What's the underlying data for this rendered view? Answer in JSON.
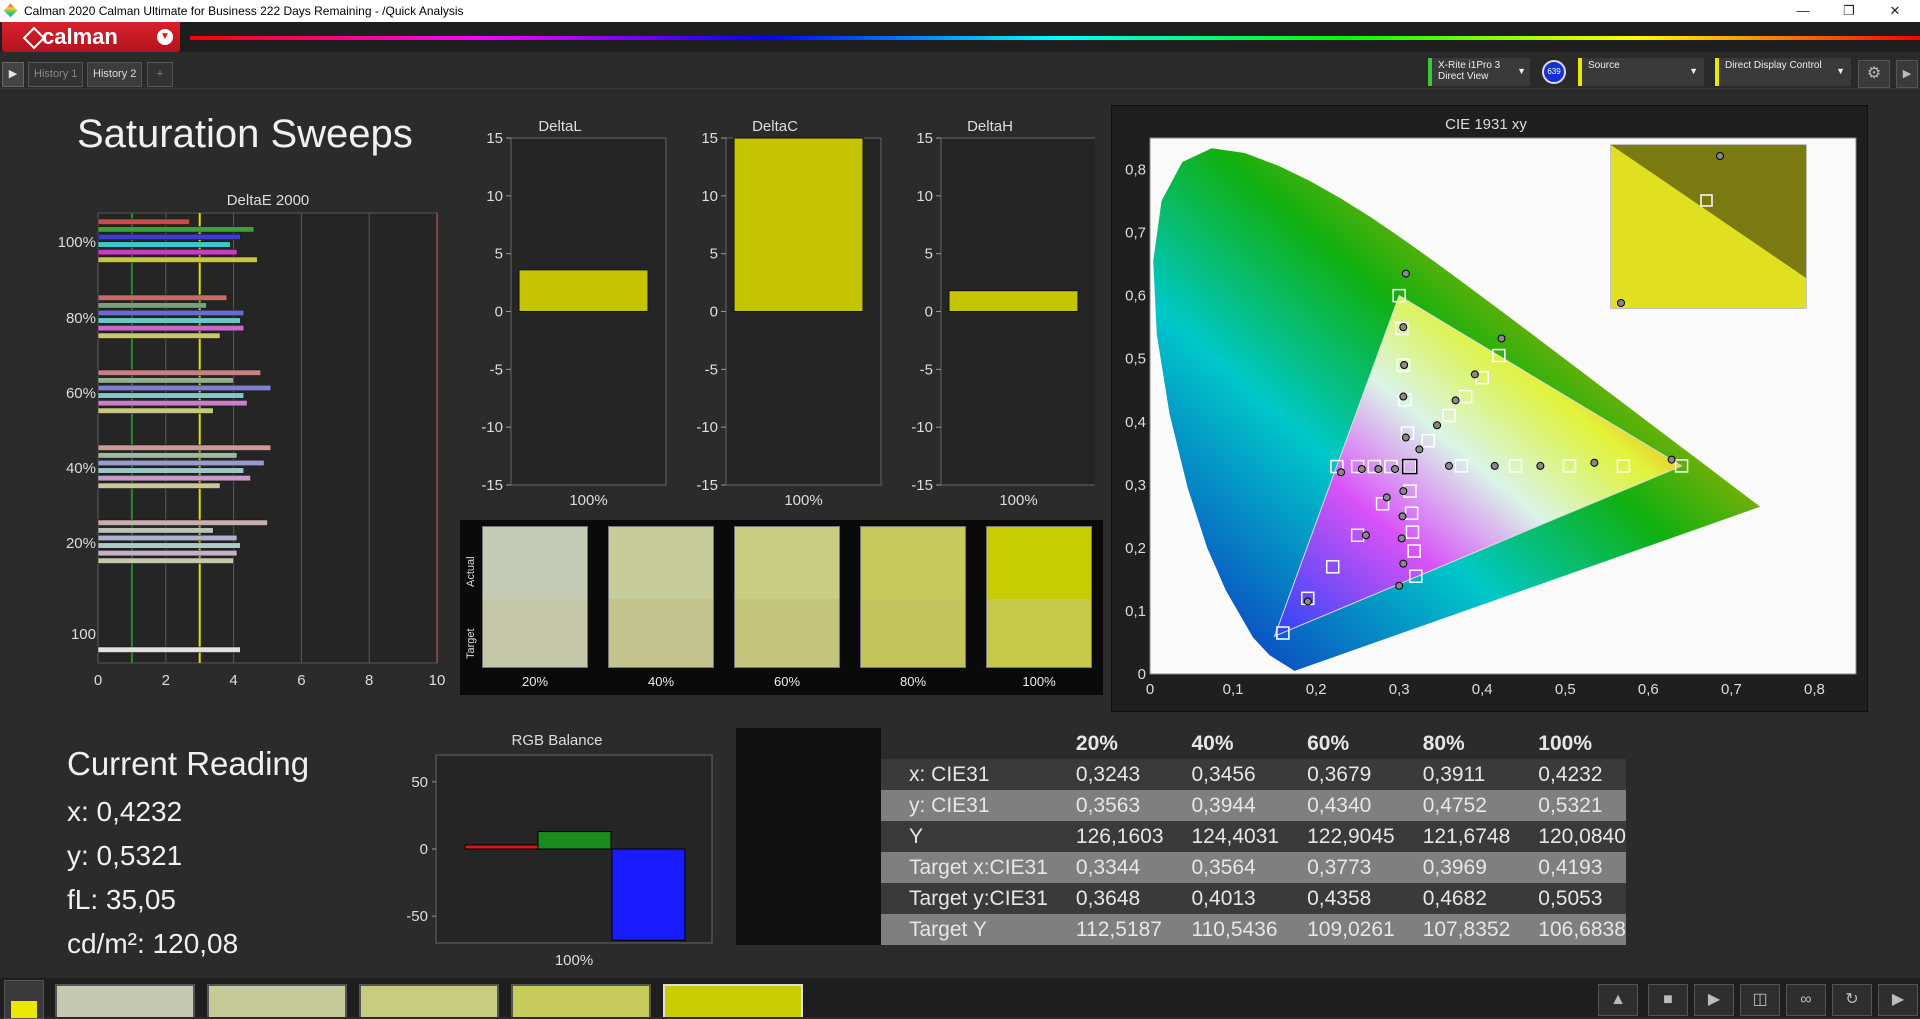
{
  "window": {
    "title": "Calman 2020 Calman Ultimate for Business 222 Days Remaining - /Quick Analysis"
  },
  "logo": {
    "text": "calman"
  },
  "tabs": [
    {
      "label": "History 1"
    },
    {
      "label": "History 2"
    },
    {
      "label": "+"
    }
  ],
  "devices": {
    "meter_line1": "X-Rite i1Pro 3",
    "meter_line2": "Direct View",
    "meter_badge": "639",
    "source": "Source",
    "display": "Direct Display Control"
  },
  "page_title": "Saturation Sweeps",
  "deltaE": {
    "title": "DeltaE 2000",
    "x_ticks": [
      "0",
      "2",
      "4",
      "6",
      "8",
      "10"
    ],
    "x_range": [
      0,
      10
    ],
    "group_labels": [
      "100%",
      "80%",
      "60%",
      "40%",
      "20%",
      "100"
    ],
    "groups": [
      {
        "colors": [
          "#c84a4a",
          "#3aa03a",
          "#3c3cd0",
          "#3cc8c8",
          "#c83cc8",
          "#c8c83c"
        ],
        "values": [
          2.7,
          4.6,
          4.2,
          3.9,
          4.1,
          4.7
        ]
      },
      {
        "colors": [
          "#c86a6a",
          "#7aa07a",
          "#6a6ad0",
          "#6ac8c8",
          "#c86ac8",
          "#c8c86a"
        ],
        "values": [
          3.8,
          3.2,
          4.3,
          4.2,
          4.3,
          3.6
        ]
      },
      {
        "colors": [
          "#c88080",
          "#90b090",
          "#8080d0",
          "#80c8c8",
          "#c880c8",
          "#c8c880"
        ],
        "values": [
          4.8,
          4.0,
          5.1,
          4.3,
          4.4,
          3.4
        ]
      },
      {
        "colors": [
          "#c89a9a",
          "#a0b8a0",
          "#9a9ad0",
          "#9ac8c8",
          "#c89ac8",
          "#c8c89a"
        ],
        "values": [
          5.1,
          4.1,
          4.9,
          4.3,
          4.5,
          3.6
        ]
      },
      {
        "colors": [
          "#c8b0b0",
          "#b8c4b8",
          "#b0b0d0",
          "#b0c8c8",
          "#c8b0c8",
          "#c8c8b0"
        ],
        "values": [
          5.0,
          3.4,
          4.1,
          4.2,
          4.1,
          4.0
        ]
      },
      {
        "colors": [
          "#e0e0e0"
        ],
        "values": [
          4.2
        ]
      }
    ],
    "threshold_green": 1,
    "threshold_yellow": 3
  },
  "deltaL": {
    "title": "DeltaL",
    "value": 3.6,
    "label": "100%"
  },
  "deltaC": {
    "title": "DeltaC",
    "value": 15,
    "label": "100%"
  },
  "deltaH": {
    "title": "DeltaH",
    "value": 1.8,
    "label": "100%"
  },
  "delta_y_ticks": [
    "15",
    "10",
    "5",
    "0",
    "-5",
    "-10",
    "-15"
  ],
  "swatches": {
    "actual_label": "Actual",
    "target_label": "Target",
    "items": [
      {
        "label": "20%",
        "actual": "#c5cab4",
        "target": "#c4c7a8"
      },
      {
        "label": "40%",
        "actual": "#c6cc9a",
        "target": "#c3c48e"
      },
      {
        "label": "60%",
        "actual": "#c8cd84",
        "target": "#c3c57c"
      },
      {
        "label": "80%",
        "actual": "#c4c95a",
        "target": "#c3c45c"
      },
      {
        "label": "100%",
        "actual": "#c7cd00",
        "target": "#c6c84a"
      }
    ]
  },
  "cie": {
    "title": "CIE 1931 xy",
    "x_ticks": [
      "0",
      "0,1",
      "0,2",
      "0,3",
      "0,4",
      "0,5",
      "0,6",
      "0,7",
      "0,8"
    ],
    "y_ticks": [
      "0",
      "0,1",
      "0,2",
      "0,3",
      "0,4",
      "0,5",
      "0,6",
      "0,7",
      "0,8"
    ],
    "x_range": [
      0,
      0.85
    ],
    "y_range": [
      0,
      0.85
    ]
  },
  "current_reading": {
    "title": "Current Reading",
    "x": "x: 0,4232",
    "y": "y: 0,5321",
    "fl": "fL: 35,05",
    "cdm2": "cd/m²: 120,08"
  },
  "rgb_balance": {
    "title": "RGB Balance",
    "y_ticks": [
      "50",
      "0",
      "-50"
    ],
    "y_range": [
      -70,
      70
    ],
    "label": "100%",
    "values": {
      "red": 3,
      "green": 13,
      "blue": -68
    }
  },
  "table": {
    "headers": [
      "",
      "20%",
      "40%",
      "60%",
      "80%",
      "100%"
    ],
    "rows": [
      [
        "x: CIE31",
        "0,3243",
        "0,3456",
        "0,3679",
        "0,3911",
        "0,4232"
      ],
      [
        "y: CIE31",
        "0,3563",
        "0,3944",
        "0,4340",
        "0,4752",
        "0,5321"
      ],
      [
        "Y",
        "126,1603",
        "124,4031",
        "122,9045",
        "121,6748",
        "120,0840"
      ],
      [
        "Target x:CIE31",
        "0,3344",
        "0,3564",
        "0,3773",
        "0,3969",
        "0,4193"
      ],
      [
        "Target y:CIE31",
        "0,3648",
        "0,4013",
        "0,4358",
        "0,4682",
        "0,5053"
      ],
      [
        "Target Y",
        "112,5187",
        "110,5436",
        "109,0261",
        "107,8352",
        "106,6838"
      ]
    ]
  },
  "bottom_swatches": [
    "#c5c9b2",
    "#c6ca98",
    "#c8cc80",
    "#c8cc5c",
    "#c9cd00"
  ],
  "colors": {
    "accent": "#d8222e",
    "yellow": "#c8c800"
  }
}
